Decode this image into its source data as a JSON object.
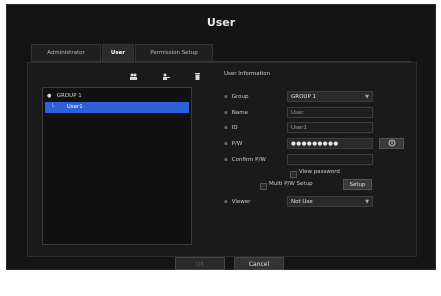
{
  "window": {
    "title": "User"
  },
  "tabs": [
    {
      "label": "Administrator",
      "active": false
    },
    {
      "label": "User",
      "active": true
    },
    {
      "label": "Permission Setup",
      "active": false
    }
  ],
  "toolbar": {
    "icons": [
      "add-group-icon",
      "add-user-icon",
      "delete-icon"
    ]
  },
  "tree": {
    "group": "GROUP 1",
    "user": "User1"
  },
  "user_info": {
    "section_title": "User Information",
    "group_label": "Group",
    "group_value": "GROUP 1",
    "name_label": "Name",
    "name_placeholder": "User",
    "id_label": "ID",
    "id_value": "User1",
    "pw_label": "P/W",
    "pw_value": "●●●●●●●●●",
    "confirm_label": "Confirm P/W",
    "view_password_label": "View password",
    "multi_pw_label": "Multi P/W Setup",
    "setup_button": "Setup",
    "viewer_label": "Viewer",
    "viewer_value": "Not Use"
  },
  "footer": {
    "ok": "OK",
    "cancel": "Cancel"
  },
  "colors": {
    "selection": "#2b62d9",
    "background": "#141414"
  }
}
